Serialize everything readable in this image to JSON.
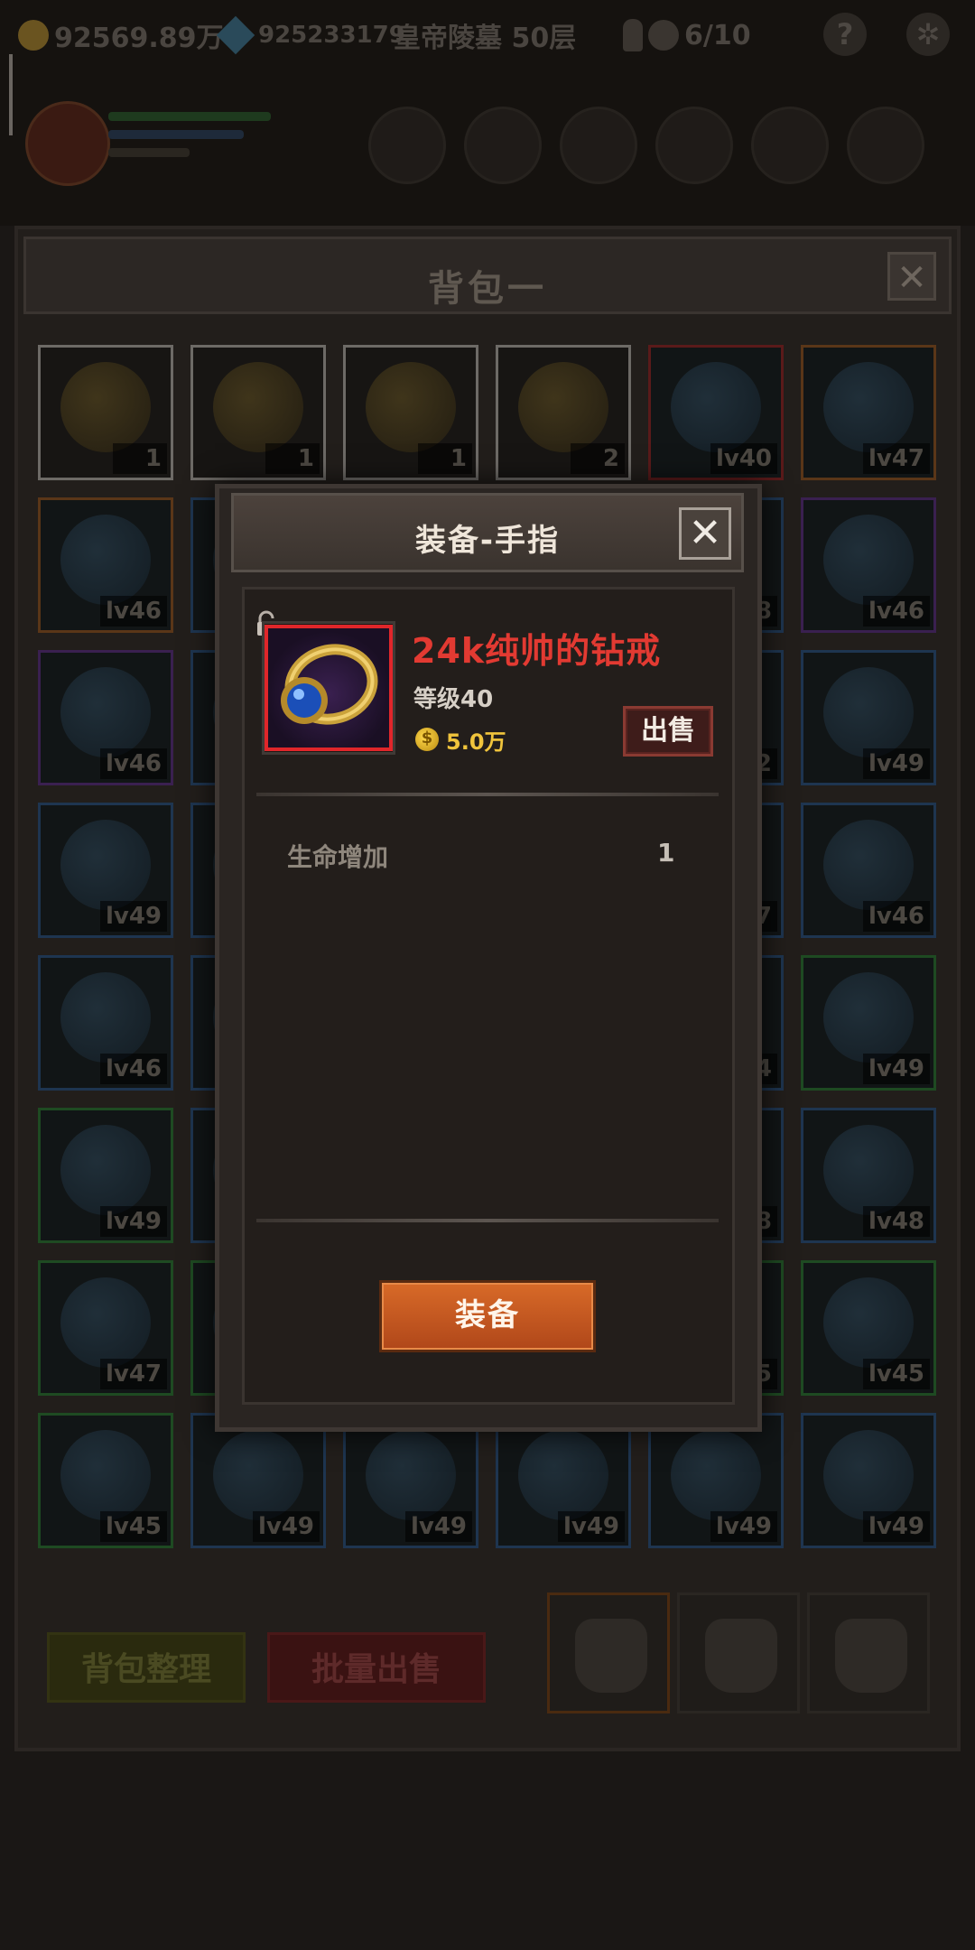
{
  "hud": {
    "gold": "92569.89万",
    "gems": "925233179",
    "stage": "皇帝陵墓 50层",
    "keys_progress": "6/10",
    "help_label": "?"
  },
  "bag": {
    "title": "背包一",
    "close_label": "✕",
    "slots": [
      {
        "label": "1",
        "color": "white"
      },
      {
        "label": "1",
        "color": "white"
      },
      {
        "label": "1",
        "color": "white"
      },
      {
        "label": "2",
        "color": "white"
      },
      {
        "label": "lv40",
        "color": "red"
      },
      {
        "label": "lv47",
        "color": "orange"
      },
      {
        "label": "lv46",
        "color": "orange"
      },
      {
        "label": "",
        "color": "blue"
      },
      {
        "label": "",
        "color": "blue"
      },
      {
        "label": "",
        "color": "blue"
      },
      {
        "label": "8",
        "color": "blue"
      },
      {
        "label": "lv46",
        "color": "purple"
      },
      {
        "label": "lv46",
        "color": "purple"
      },
      {
        "label": "",
        "color": "blue"
      },
      {
        "label": "",
        "color": "blue"
      },
      {
        "label": "",
        "color": "blue"
      },
      {
        "label": "2",
        "color": "blue"
      },
      {
        "label": "lv49",
        "color": "blue"
      },
      {
        "label": "lv49",
        "color": "blue"
      },
      {
        "label": "",
        "color": "blue"
      },
      {
        "label": "",
        "color": "blue"
      },
      {
        "label": "",
        "color": "blue"
      },
      {
        "label": "7",
        "color": "blue"
      },
      {
        "label": "lv46",
        "color": "blue"
      },
      {
        "label": "lv46",
        "color": "blue"
      },
      {
        "label": "",
        "color": "blue"
      },
      {
        "label": "",
        "color": "blue"
      },
      {
        "label": "",
        "color": "blue"
      },
      {
        "label": "4",
        "color": "blue"
      },
      {
        "label": "lv49",
        "color": "green"
      },
      {
        "label": "lv49",
        "color": "green"
      },
      {
        "label": "",
        "color": "blue"
      },
      {
        "label": "",
        "color": "blue"
      },
      {
        "label": "",
        "color": "blue"
      },
      {
        "label": "8",
        "color": "blue"
      },
      {
        "label": "lv48",
        "color": "blue"
      },
      {
        "label": "lv47",
        "color": "green"
      },
      {
        "label": "",
        "color": "green"
      },
      {
        "label": "",
        "color": "blue"
      },
      {
        "label": "",
        "color": "blue"
      },
      {
        "label": "5",
        "color": "green"
      },
      {
        "label": "lv45",
        "color": "green"
      },
      {
        "label": "lv45",
        "color": "green"
      },
      {
        "label": "lv49",
        "color": "blue"
      },
      {
        "label": "lv49",
        "color": "blue"
      },
      {
        "label": "lv49",
        "color": "blue"
      },
      {
        "label": "lv49",
        "color": "blue"
      },
      {
        "label": "lv49",
        "color": "blue"
      }
    ],
    "organize_label": "背包整理",
    "bulk_sell_label": "批量出售"
  },
  "dialog": {
    "title": "装备-手指",
    "close_label": "✕",
    "item": {
      "name": "24k纯帅的钻戒",
      "level": "等级40",
      "price": "5.0万",
      "name_color": "#e23a32",
      "frame_color": "#e0262a"
    },
    "sell_label": "出售",
    "stats": [
      {
        "name": "生命增加",
        "value": "1"
      }
    ],
    "equip_label": "装备"
  }
}
